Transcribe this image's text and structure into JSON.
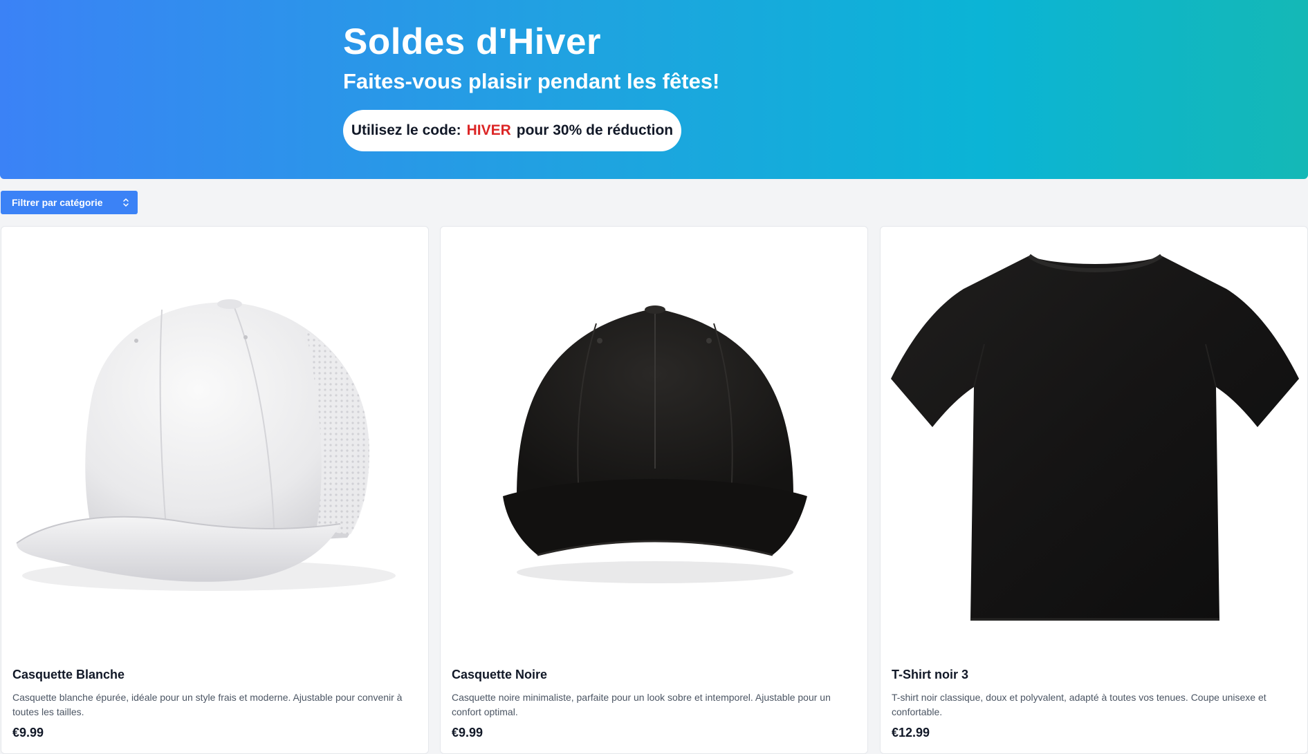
{
  "hero": {
    "title": "Soldes d'Hiver",
    "subtitle": "Faites-vous plaisir pendant les fêtes!",
    "promo_prefix": "Utilisez le code:",
    "promo_code": "HIVER",
    "promo_suffix": "pour 30% de réduction",
    "gradient_start": "#3b82f6",
    "gradient_end": "#14b8b6",
    "code_color": "#dc2626"
  },
  "filter": {
    "label": "Filtrer par catégorie",
    "icon": "chevron-up-down-icon"
  },
  "products": [
    {
      "title": "Casquette Blanche",
      "description": "Casquette blanche épurée, idéale pour un style frais et moderne. Ajustable pour convenir à toutes les tailles.",
      "price": "€9.99",
      "image": "white-cap-image"
    },
    {
      "title": "Casquette Noire",
      "description": "Casquette noire minimaliste, parfaite pour un look sobre et intemporel. Ajustable pour un confort optimal.",
      "price": "€9.99",
      "image": "black-cap-image"
    },
    {
      "title": "T-Shirt noir 3",
      "description": "T-shirt noir classique, doux et polyvalent, adapté à toutes vos tenues. Coupe unisexe et confortable.",
      "price": "€12.99",
      "image": "black-tshirt-image"
    }
  ]
}
